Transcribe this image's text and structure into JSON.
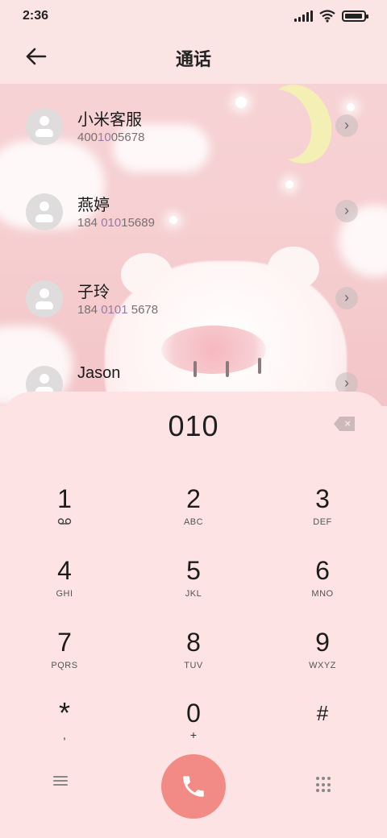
{
  "status_bar": {
    "time": "2:36",
    "icons": [
      "signal-icon",
      "wifi-icon",
      "battery-icon"
    ]
  },
  "header": {
    "title": "通话",
    "back_icon": "arrow-left-icon"
  },
  "contacts": [
    {
      "name": "小米客服",
      "number_pre": "400",
      "number_match": "10",
      "number_post": "05678"
    },
    {
      "name": "燕婷",
      "number_pre": "184 ",
      "number_match": "010",
      "number_post": "15689"
    },
    {
      "name": "子玲",
      "number_pre": "184 ",
      "number_match": "0101",
      "number_post": " 5678"
    },
    {
      "name": "Jason",
      "number_pre": "",
      "number_match": "",
      "number_post": ""
    }
  ],
  "dialer": {
    "number": "010",
    "keys": [
      {
        "digit": "1",
        "letters": ""
      },
      {
        "digit": "2",
        "letters": "ABC"
      },
      {
        "digit": "3",
        "letters": "DEF"
      },
      {
        "digit": "4",
        "letters": "GHI"
      },
      {
        "digit": "5",
        "letters": "JKL"
      },
      {
        "digit": "6",
        "letters": "MNO"
      },
      {
        "digit": "7",
        "letters": "PQRS"
      },
      {
        "digit": "8",
        "letters": "TUV"
      },
      {
        "digit": "9",
        "letters": "WXYZ"
      },
      {
        "digit": "*",
        "letters": ","
      },
      {
        "digit": "0",
        "letters": "+"
      },
      {
        "digit": "#",
        "letters": ""
      }
    ]
  },
  "colors": {
    "panel_bg": "#fde3e3",
    "call_button": "#f28b86",
    "match_highlight": "#9a7aa4"
  }
}
